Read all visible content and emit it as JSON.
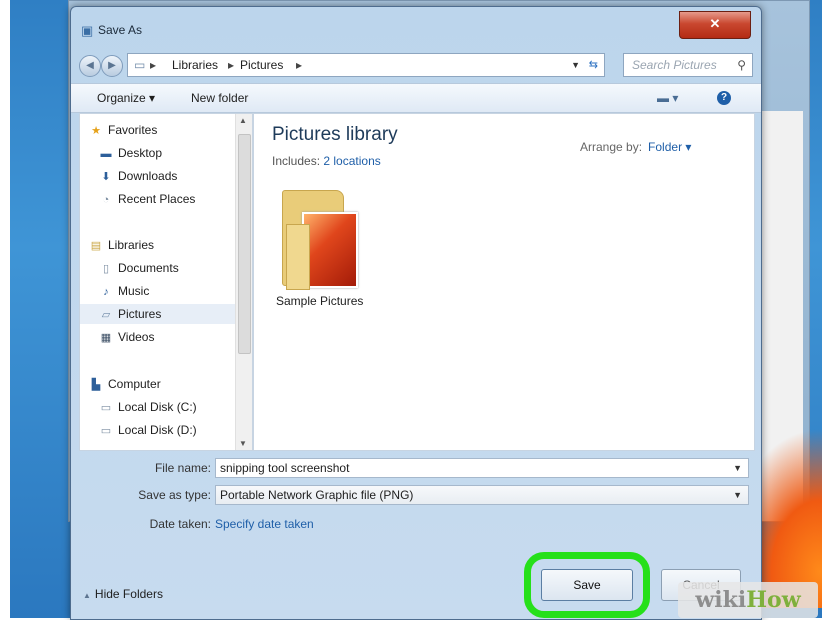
{
  "window": {
    "title": "Save As",
    "close_glyph": "✕"
  },
  "address": {
    "crumbs": [
      "Libraries",
      "Pictures"
    ],
    "sep": "▸",
    "search_placeholder": "Search Pictures"
  },
  "toolbar": {
    "organize": "Organize ▾",
    "new_folder": "New folder",
    "help": "?"
  },
  "sidebar": {
    "items": [
      {
        "label": "Favorites",
        "icon": "star-icon"
      },
      {
        "label": "Desktop",
        "icon": "desktop-icon"
      },
      {
        "label": "Downloads",
        "icon": "downloads-icon"
      },
      {
        "label": "Recent Places",
        "icon": "recent-places-icon"
      },
      {
        "label": "Libraries",
        "icon": "libraries-icon"
      },
      {
        "label": "Documents",
        "icon": "documents-icon"
      },
      {
        "label": "Music",
        "icon": "music-icon"
      },
      {
        "label": "Pictures",
        "icon": "pictures-icon"
      },
      {
        "label": "Videos",
        "icon": "videos-icon"
      },
      {
        "label": "Computer",
        "icon": "computer-icon"
      },
      {
        "label": "Local Disk (C:)",
        "icon": "drive-icon"
      },
      {
        "label": "Local Disk (D:)",
        "icon": "drive-icon"
      }
    ],
    "selected": "Pictures"
  },
  "content": {
    "library_title": "Pictures library",
    "includes_label": "Includes:",
    "includes_link": "2 locations",
    "arrange_label": "Arrange by:",
    "arrange_value": "Folder ▾",
    "items": [
      {
        "name": "Sample Pictures",
        "icon": "folder-icon"
      }
    ]
  },
  "form": {
    "file_name_label": "File name:",
    "file_name_value": "snipping tool screenshot",
    "save_type_label": "Save as type:",
    "save_type_value": "Portable Network Graphic file (PNG)",
    "date_taken_label": "Date taken:",
    "date_taken_link": "Specify date taken"
  },
  "footer": {
    "hide_folders": "Hide Folders",
    "save": "Save",
    "cancel": "Cancel"
  },
  "watermark": {
    "part1": "wiki",
    "part2": "How"
  },
  "colors": {
    "highlight": "#26e01a",
    "link": "#1f5fa8",
    "close": "#c9472f"
  }
}
